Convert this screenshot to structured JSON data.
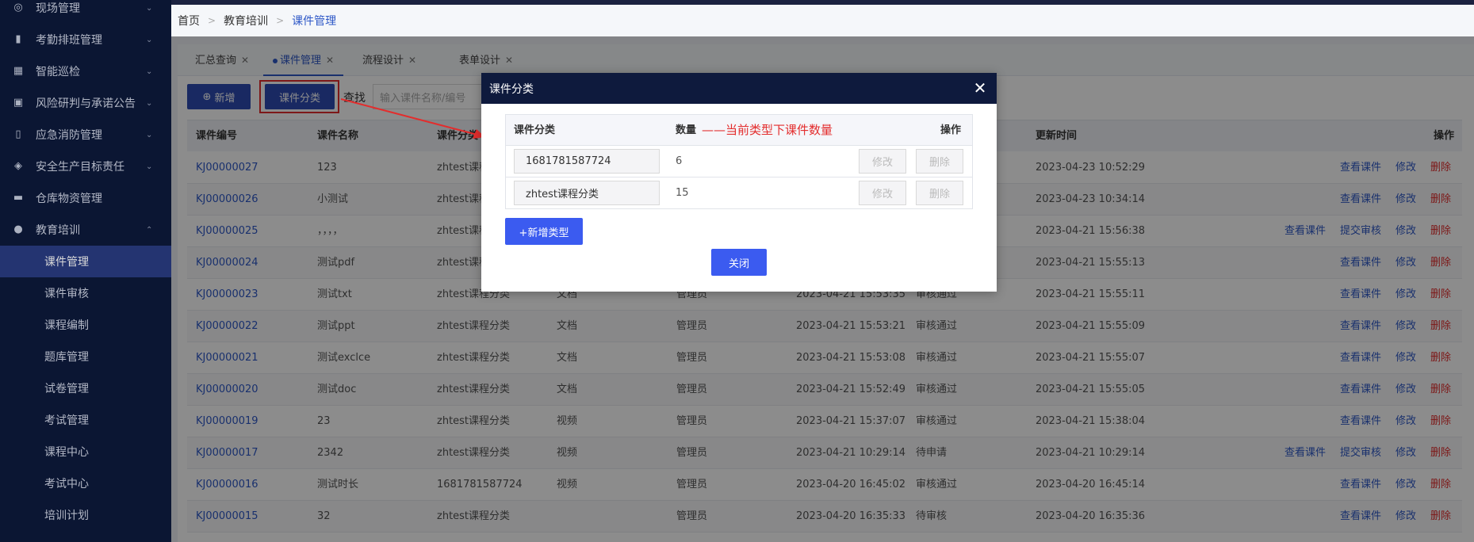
{
  "sidebar": {
    "items": [
      {
        "label": "现场管理",
        "icon": "shield-icon"
      },
      {
        "label": "考勤排班管理",
        "icon": "bar-chart-icon"
      },
      {
        "label": "智能巡检",
        "icon": "grid-icon"
      },
      {
        "label": "风险研判与承诺公告",
        "icon": "briefcase-icon"
      },
      {
        "label": "应急消防管理",
        "icon": "fire-extinguisher-icon"
      },
      {
        "label": "安全生产目标责任",
        "icon": "target-icon"
      },
      {
        "label": "仓库物资管理",
        "icon": "folder-icon"
      },
      {
        "label": "教育培训",
        "icon": "user-icon"
      }
    ],
    "sub_items": [
      "课件管理",
      "课件审核",
      "课程编制",
      "题库管理",
      "试卷管理",
      "考试管理",
      "课程中心",
      "考试中心",
      "培训计划"
    ],
    "active_sub": "课件管理"
  },
  "breadcrumb": {
    "home": "首页",
    "parent": "教育培训",
    "current": "课件管理"
  },
  "tabs": [
    {
      "label": "汇总查询"
    },
    {
      "label": "课件管理"
    },
    {
      "label": "流程设计"
    },
    {
      "label": "表单设计"
    }
  ],
  "toolbar": {
    "add_label": "新增",
    "category_label": "课件分类",
    "search_label": "查找",
    "search_placeholder": "输入课件名称/编号"
  },
  "table": {
    "headers": {
      "code": "课件编号",
      "name": "课件名称",
      "category": "课件分类",
      "update_time": "更新时间",
      "actions": "操作"
    },
    "rows": [
      {
        "code": "KJ00000027",
        "name": "123",
        "category": "zhtest课程",
        "type": "",
        "author": "",
        "created": "",
        "status": "",
        "updated": "2023-04-23 10:52:29",
        "actions": [
          "查看课件",
          "修改",
          "删除"
        ]
      },
      {
        "code": "KJ00000026",
        "name": "小测试",
        "category": "zhtest课程",
        "type": "",
        "author": "",
        "created": "",
        "status": "",
        "updated": "2023-04-23 10:34:14",
        "actions": [
          "查看课件",
          "修改",
          "删除"
        ]
      },
      {
        "code": "KJ00000025",
        "name": "，，，，",
        "category": "zhtest课程",
        "type": "",
        "author": "",
        "created": "",
        "status": "",
        "updated": "2023-04-21 15:56:38",
        "actions": [
          "查看课件",
          "提交审核",
          "修改",
          "删除"
        ]
      },
      {
        "code": "KJ00000024",
        "name": "测试pdf",
        "category": "zhtest课程",
        "type": "",
        "author": "",
        "created": "",
        "status": "",
        "updated": "2023-04-21 15:55:13",
        "actions": [
          "查看课件",
          "修改",
          "删除"
        ]
      },
      {
        "code": "KJ00000023",
        "name": "测试txt",
        "category": "zhtest课程分类",
        "type": "文档",
        "author": "管理员",
        "created": "2023-04-21 15:53:35",
        "status": "审核通过",
        "updated": "2023-04-21 15:55:11",
        "actions": [
          "查看课件",
          "修改",
          "删除"
        ]
      },
      {
        "code": "KJ00000022",
        "name": "测试ppt",
        "category": "zhtest课程分类",
        "type": "文档",
        "author": "管理员",
        "created": "2023-04-21 15:53:21",
        "status": "审核通过",
        "updated": "2023-04-21 15:55:09",
        "actions": [
          "查看课件",
          "修改",
          "删除"
        ]
      },
      {
        "code": "KJ00000021",
        "name": "测试exclce",
        "category": "zhtest课程分类",
        "type": "文档",
        "author": "管理员",
        "created": "2023-04-21 15:53:08",
        "status": "审核通过",
        "updated": "2023-04-21 15:55:07",
        "actions": [
          "查看课件",
          "修改",
          "删除"
        ]
      },
      {
        "code": "KJ00000020",
        "name": "测试doc",
        "category": "zhtest课程分类",
        "type": "文档",
        "author": "管理员",
        "created": "2023-04-21 15:52:49",
        "status": "审核通过",
        "updated": "2023-04-21 15:55:05",
        "actions": [
          "查看课件",
          "修改",
          "删除"
        ]
      },
      {
        "code": "KJ00000019",
        "name": "23",
        "category": "zhtest课程分类",
        "type": "视频",
        "author": "管理员",
        "created": "2023-04-21 15:37:07",
        "status": "审核通过",
        "updated": "2023-04-21 15:38:04",
        "actions": [
          "查看课件",
          "修改",
          "删除"
        ]
      },
      {
        "code": "KJ00000017",
        "name": "2342",
        "category": "zhtest课程分类",
        "type": "视频",
        "author": "管理员",
        "created": "2023-04-21 10:29:14",
        "status": "待申请",
        "updated": "2023-04-21 10:29:14",
        "actions": [
          "查看课件",
          "提交审核",
          "修改",
          "删除"
        ]
      },
      {
        "code": "KJ00000016",
        "name": "测试时长",
        "category": "1681781587724",
        "type": "视频",
        "author": "管理员",
        "created": "2023-04-20 16:45:02",
        "status": "审核通过",
        "updated": "2023-04-20 16:45:14",
        "actions": [
          "查看课件",
          "修改",
          "删除"
        ]
      },
      {
        "code": "KJ00000015",
        "name": "32",
        "category": "zhtest课程分类",
        "type": "",
        "author": "管理员",
        "created": "2023-04-20 16:35:33",
        "status": "待审核",
        "updated": "2023-04-20 16:35:36",
        "actions": [
          "查看课件",
          "修改",
          "删除"
        ]
      }
    ]
  },
  "modal": {
    "title": "课件分类",
    "headers": {
      "category": "课件分类",
      "count": "数量",
      "actions": "操作"
    },
    "annotation": "——当前类型下课件数量",
    "rows": [
      {
        "category": "1681781587724",
        "count": "6",
        "edit": "修改",
        "delete": "删除"
      },
      {
        "category": "zhtest课程分类",
        "count": "15",
        "edit": "修改",
        "delete": "删除"
      }
    ],
    "add_type_label": "+新增类型",
    "close_label": "关闭"
  },
  "colors": {
    "sidebar_bg": "#0e1a3d",
    "primary": "#2e4bb3",
    "modal_button": "#3b5bf0",
    "link": "#2e58c7",
    "danger": "#e32d2d"
  }
}
